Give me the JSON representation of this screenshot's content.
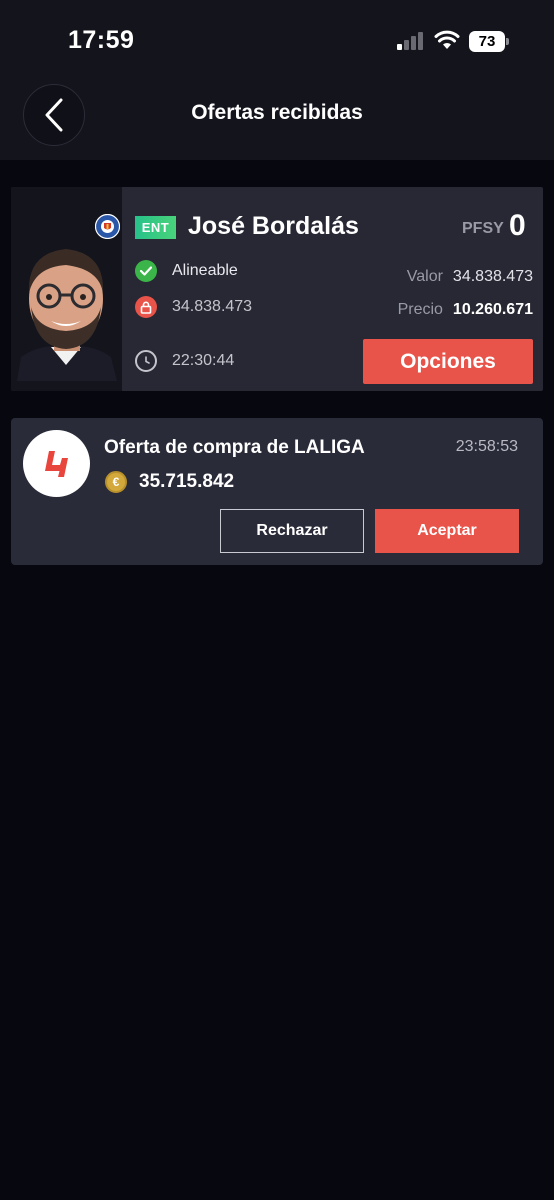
{
  "status_bar": {
    "time": "17:59",
    "battery": "73"
  },
  "header": {
    "title": "Ofertas recibidas"
  },
  "player": {
    "position": "ENT",
    "name": "José Bordalás",
    "pfsy_label": "PFSY",
    "pfsy_value": "0",
    "availability": "Alineable",
    "clause": "34.838.473",
    "value_label": "Valor",
    "value": "34.838.473",
    "price_label": "Precio",
    "price": "10.260.671",
    "time": "22:30:44",
    "options_label": "Opciones"
  },
  "offer": {
    "title": "Oferta de compra de LALIGA",
    "time": "23:58:53",
    "currency_symbol": "€",
    "amount": "35.715.842",
    "reject_label": "Rechazar",
    "accept_label": "Aceptar"
  },
  "colors": {
    "accent": "#e8534a",
    "background": "#07070f",
    "card": "#272833",
    "available": "#3bb54a",
    "locked": "#e8534a",
    "coin": "#d3a93b"
  }
}
